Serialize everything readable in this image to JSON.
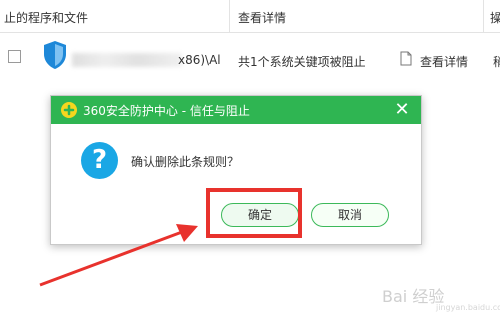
{
  "table": {
    "header": {
      "col_program": "止的程序和文件",
      "col_detail": "查看详情",
      "col_cut": "操"
    },
    "row": {
      "path_suffix": "x86)\\Al",
      "rule_text": "共1个系统关键项被阻止",
      "detail_link": "查看详情",
      "cut_text": "稍"
    }
  },
  "dialog": {
    "title": "360安全防护中心 - 信任与阻止",
    "close": "✕",
    "question_glyph": "?",
    "message": "确认删除此条规则？",
    "ok_label": "确定",
    "cancel_label": "取消"
  },
  "watermark": {
    "brand": "Bai 经验",
    "url": "jingyan.baidu.com"
  },
  "colors": {
    "title_bar": "#2fb552",
    "question": "#1aa7e5",
    "highlight": "#e8322d"
  }
}
